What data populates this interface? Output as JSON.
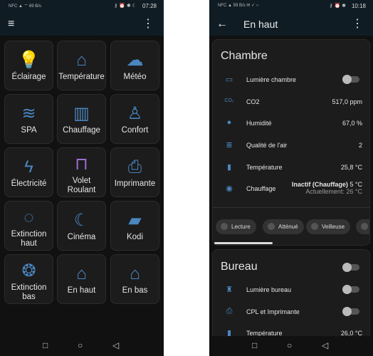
{
  "left": {
    "status": {
      "time": "07:28",
      "indicators": "NFC ▲ ⌔ 69 B/s",
      "right_icons": "key alarm bluetooth moon 40"
    },
    "menu_icon": "hamburger-icon",
    "more_icon": "more-vert-icon",
    "tiles": [
      {
        "label": "Éclairage",
        "icon": "lightbulb-group-icon",
        "color": "#4a86c0"
      },
      {
        "label": "Température",
        "icon": "home-thermometer-icon",
        "color": "#4a86c0"
      },
      {
        "label": "Météo",
        "icon": "weather-partly-cloudy-icon",
        "color": "#4a86c0"
      },
      {
        "label": "SPA",
        "icon": "pool-icon",
        "color": "#4a86c0"
      },
      {
        "label": "Chauffage",
        "icon": "radiator-icon",
        "color": "#4a86c0"
      },
      {
        "label": "Confort",
        "icon": "human-thermometer-icon",
        "color": "#4a86c0"
      },
      {
        "label": "Électricité",
        "icon": "flash-icon",
        "color": "#4a86c0"
      },
      {
        "label": "Volet Roulant",
        "icon": "window-shutter-icon",
        "color": "#9b6fd0"
      },
      {
        "label": "Imprimante",
        "icon": "printer-network-icon",
        "color": "#4a86c0"
      },
      {
        "label": "Extinction haut",
        "icon": "lightbulb-off-icon",
        "color": "#4a86c0"
      },
      {
        "label": "Cinéma",
        "icon": "lightbulb-night-icon",
        "color": "#4a86c0"
      },
      {
        "label": "Kodi",
        "icon": "movie-clapper-icon",
        "color": "#4a86c0"
      },
      {
        "label": "Extinction bas",
        "icon": "lightbulb-group-off-icon",
        "color": "#4a86c0"
      },
      {
        "label": "En haut",
        "icon": "home-floor-up-icon",
        "color": "#4a86c0"
      },
      {
        "label": "En bas",
        "icon": "home-floor-down-icon",
        "color": "#4a86c0"
      }
    ]
  },
  "right": {
    "status": {
      "time": "10:18",
      "indicators": "NFC ▲ 59 B/s ✉ ✓ ○",
      "right_icons": "key alarm bluetooth 80"
    },
    "title": "En haut",
    "chambre": {
      "title": "Chambre",
      "rows": [
        {
          "label": "Lumière chambre",
          "icon": "bed-icon",
          "toggle": false
        },
        {
          "label": "CO2",
          "icon": "co2-icon",
          "value": "517,0 ppm"
        },
        {
          "label": "Humidité",
          "icon": "water-percent-icon",
          "value": "67,0 %"
        },
        {
          "label": "Qualité de l'air",
          "icon": "air-filter-icon",
          "value": "2"
        },
        {
          "label": "Température",
          "icon": "thermometer-icon",
          "value": "25,8 °C"
        },
        {
          "label": "Chauffage",
          "icon": "thermostat-icon",
          "value_bold": "Inactif (Chauffage)",
          "value": "5 °C",
          "sub": "Actuellement: 26 °C"
        }
      ],
      "chips": [
        "Lecture",
        "Atténué",
        "Veilleuse",
        "A"
      ]
    },
    "bureau": {
      "title": "Bureau",
      "toggle": false,
      "rows": [
        {
          "label": "Lumière bureau",
          "icon": "desk-chair-icon",
          "toggle": false
        },
        {
          "label": "CPL et Imprimante",
          "icon": "printer-network-icon",
          "toggle": false
        },
        {
          "label": "Température",
          "icon": "thermometer-icon",
          "value": "26,0 °C"
        }
      ]
    }
  },
  "accent": "#4a86c0"
}
